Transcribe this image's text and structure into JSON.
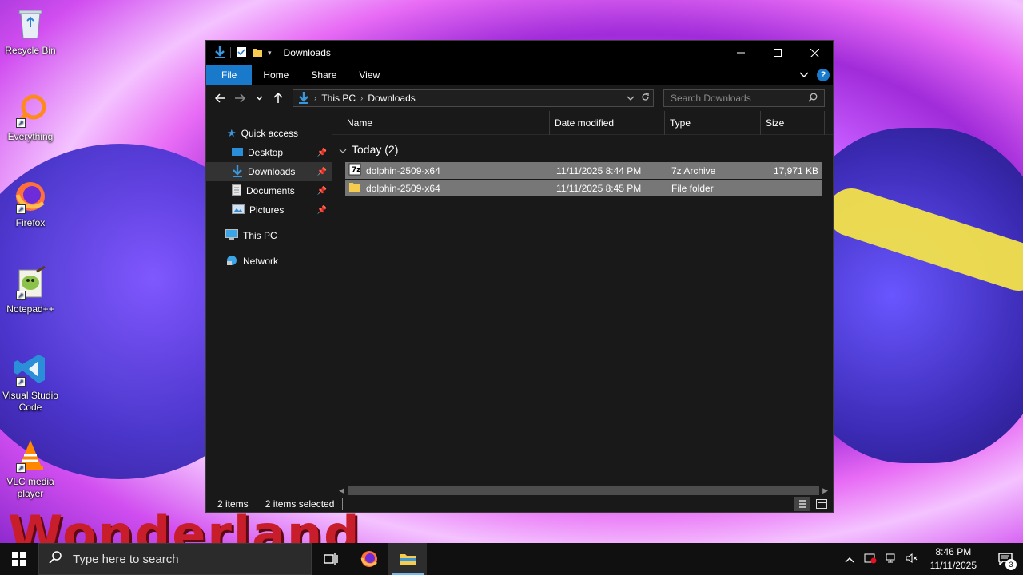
{
  "desktop": {
    "icons": [
      {
        "label": "Recycle Bin",
        "icon": "recycle-bin-icon"
      },
      {
        "label": "Everything",
        "icon": "everything-search-icon"
      },
      {
        "label": "Firefox",
        "icon": "firefox-icon"
      },
      {
        "label": "Notepad++",
        "icon": "notepad-plus-plus-icon"
      },
      {
        "label": "Visual Studio Code",
        "icon": "vscode-icon"
      },
      {
        "label": "VLC media player",
        "icon": "vlc-icon"
      }
    ],
    "wallpaper_text": "Wonderland"
  },
  "window": {
    "title": "Downloads",
    "ribbon_tabs": [
      "File",
      "Home",
      "Share",
      "View"
    ],
    "help": "?",
    "breadcrumb": [
      "This PC",
      "Downloads"
    ],
    "search_placeholder": "Search Downloads",
    "nav": {
      "quick_access": "Quick access",
      "items": [
        "Desktop",
        "Downloads",
        "Documents",
        "Pictures"
      ],
      "this_pc": "This PC",
      "network": "Network"
    },
    "columns": [
      "Name",
      "Date modified",
      "Type",
      "Size"
    ],
    "group_label": "Today (2)",
    "files": [
      {
        "name": "dolphin-2509-x64",
        "date": "11/11/2025 8:44 PM",
        "type": "7z Archive",
        "size": "17,971 KB",
        "icon": "archive-icon"
      },
      {
        "name": "dolphin-2509-x64",
        "date": "11/11/2025 8:45 PM",
        "type": "File folder",
        "size": "",
        "icon": "folder-icon"
      }
    ],
    "status": {
      "count": "2 items",
      "selected": "2 items selected"
    }
  },
  "taskbar": {
    "search_placeholder": "Type here to search",
    "time": "8:46 PM",
    "date": "11/11/2025",
    "notifications": "3"
  },
  "colors": {
    "accent": "#1979ca",
    "window_bg": "#191919",
    "selection": "#777777"
  }
}
